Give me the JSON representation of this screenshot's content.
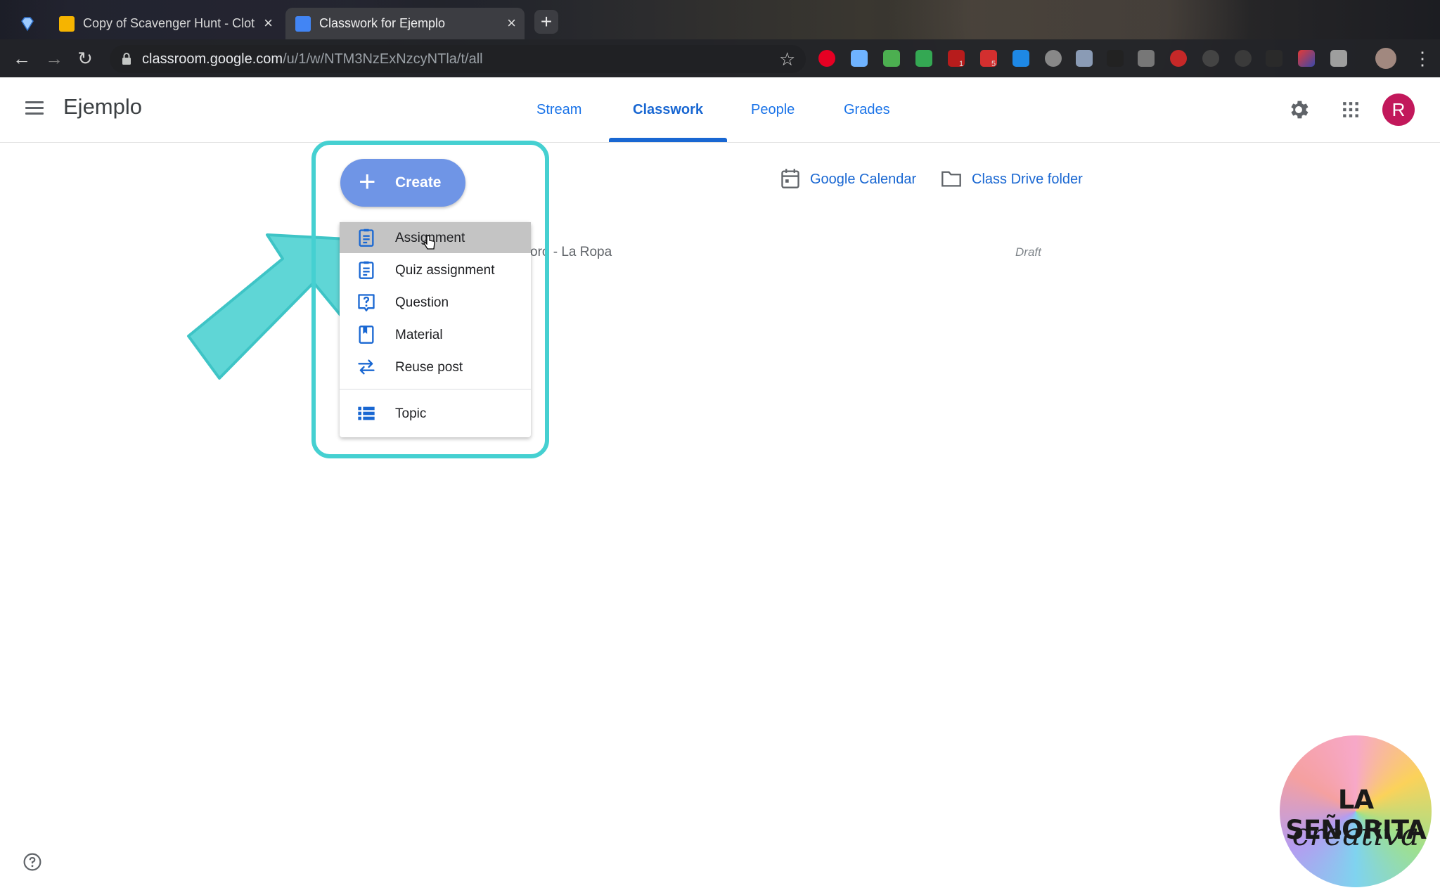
{
  "browser": {
    "tabs": [
      {
        "title": "Copy of Scavenger Hunt - Cloth",
        "active": false
      },
      {
        "title": "Classwork for Ejemplo",
        "active": true
      }
    ],
    "new_tab": "+",
    "close_glyph": "×",
    "url_host": "classroom.google.com",
    "url_path": "/u/1/w/NTM3NzExNzcyNTla/t/all",
    "extension_badges": [
      "1",
      "5"
    ]
  },
  "header": {
    "class_name": "Ejemplo",
    "nav": [
      "Stream",
      "Classwork",
      "People",
      "Grades"
    ],
    "active_nav": "Classwork",
    "avatar_letter": "R"
  },
  "content": {
    "create_label": "Create",
    "create_glyph": "+",
    "links": {
      "calendar": "Google Calendar",
      "drive": "Class Drive folder"
    },
    "create_menu": [
      {
        "label": "Assignment",
        "icon": "assignment-icon",
        "hovered": true
      },
      {
        "label": "Quiz assignment",
        "icon": "quiz-icon"
      },
      {
        "label": "Question",
        "icon": "question-icon"
      },
      {
        "label": "Material",
        "icon": "material-icon"
      },
      {
        "label": "Reuse post",
        "icon": "reuse-icon"
      },
      {
        "label": "Topic",
        "icon": "topic-icon"
      }
    ],
    "partially_hidden_item": "oro - La Ropa",
    "draft_status": "Draft"
  },
  "watermark": {
    "line1": "LA SEÑORITA",
    "line2": "creativa"
  },
  "colors": {
    "accent_blue": "#1967d2",
    "create_button": "#6f95e6",
    "highlight_teal": "#45d0d1",
    "avatar": "#c2185b"
  }
}
